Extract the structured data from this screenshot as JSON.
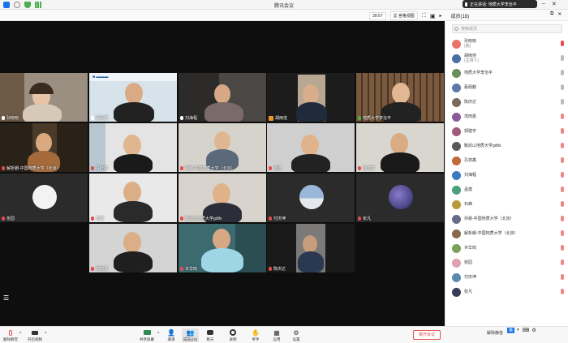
{
  "window": {
    "title": "腾讯会议"
  },
  "speaking": {
    "text": "正在讲话: 地质大学李治平"
  },
  "header": {
    "timer": "39:57",
    "view_label": "宫格视图",
    "members_label": "成员(18)"
  },
  "grid": {
    "tiles": [
      {
        "name": "孙晓晓",
        "mic": "on"
      },
      {
        "name": "蔡佩鹏",
        "mic": "on"
      },
      {
        "name": "刘海程",
        "mic": "on"
      },
      {
        "name": "胡雨佳",
        "mic": "speaking"
      },
      {
        "name": "地质大学李治平",
        "mic": "on"
      },
      {
        "name": "解析朗-中国地质大学（北京）",
        "mic": "off"
      },
      {
        "name": "许叶鑫",
        "mic": "off"
      },
      {
        "name": "孙晨-中国地质大学（北京）",
        "mic": "off"
      },
      {
        "name": "孟建",
        "mic": "off"
      },
      {
        "name": "郭建宇",
        "mic": "off"
      },
      {
        "name": "张园",
        "mic": "off"
      },
      {
        "name": "石峰",
        "mic": "off"
      },
      {
        "name": "鞍武山地质大学gdtlx",
        "mic": "off"
      },
      {
        "name": "付庆坤",
        "mic": "off"
      },
      {
        "name": "张凡",
        "mic": "off"
      },
      {
        "name": "范田嘉",
        "mic": "off"
      },
      {
        "name": "许华鸣",
        "mic": "off"
      },
      {
        "name": "陈庆达",
        "mic": "off"
      }
    ]
  },
  "sidebar": {
    "search_placeholder": "搜索成员",
    "participants": [
      {
        "name": "孙晓晓",
        "sub": "(我)",
        "color": "#e8746a"
      },
      {
        "name": "胡雨佳",
        "sub": "(主持人)",
        "color": "#4a6fa5"
      },
      {
        "name": "地质大学李治平",
        "sub": "",
        "color": "#6b8e5a"
      },
      {
        "name": "蔡佩鹏",
        "sub": "",
        "color": "#5b7aa8"
      },
      {
        "name": "陈庆达",
        "sub": "",
        "color": "#7a6a5a"
      },
      {
        "name": "范田嘉",
        "sub": "",
        "color": "#8a5a9a"
      },
      {
        "name": "郭建宇",
        "sub": "",
        "color": "#a05a7a"
      },
      {
        "name": "鞍武山地质大学gdtlx",
        "sub": "",
        "color": "#5a5a5a"
      },
      {
        "name": "孔祥鑫",
        "sub": "",
        "color": "#c06a3a"
      },
      {
        "name": "刘海程",
        "sub": "",
        "color": "#3a7ac0"
      },
      {
        "name": "孟建",
        "sub": "",
        "color": "#4aa07a"
      },
      {
        "name": "石峰",
        "sub": "",
        "color": "#b89a3a"
      },
      {
        "name": "孙晨-中国地质大学（北京）",
        "sub": "",
        "color": "#6a6a8a"
      },
      {
        "name": "解析朗-中国地质大学（北京）",
        "sub": "",
        "color": "#8a6a4a"
      },
      {
        "name": "许华鸣",
        "sub": "",
        "color": "#7aa05a"
      },
      {
        "name": "张园",
        "sub": "",
        "color": "#e0a0b0"
      },
      {
        "name": "付庆坤",
        "sub": "",
        "color": "#5a8ab0"
      },
      {
        "name": "张凡",
        "sub": "",
        "color": "#3a3a5a"
      }
    ]
  },
  "bottom": {
    "mic_label": "解除静音",
    "video_label": "开启视频",
    "share_label": "共享屏幕",
    "invite_label": "邀请",
    "members_label": "成员(18)",
    "chat_label": "聊天",
    "record_label": "录制",
    "hand_label": "举手",
    "apps_label": "应用",
    "settings_label": "设置",
    "leave_label": "离开会议",
    "mute_all_label": "解除静音"
  },
  "colors": {
    "accent": "#1a73e8",
    "danger": "#e34d4d",
    "speaking": "#f0932b"
  }
}
